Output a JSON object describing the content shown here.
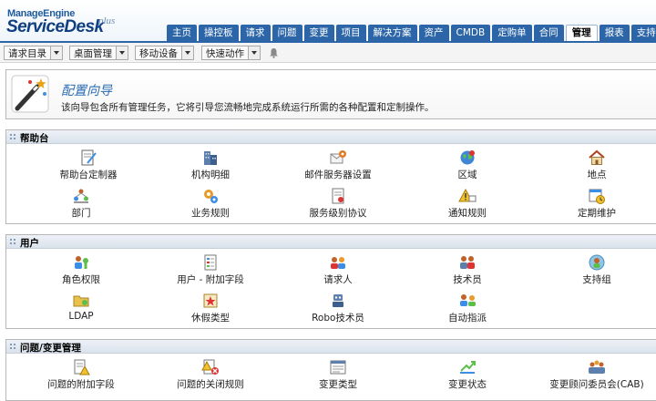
{
  "header": {
    "logo_top": "ManageEngine",
    "logo_main": "ServiceDesk",
    "logo_plus": "plus",
    "tabs": [
      {
        "label": "主页"
      },
      {
        "label": "操控板"
      },
      {
        "label": "请求"
      },
      {
        "label": "问题"
      },
      {
        "label": "变更"
      },
      {
        "label": "项目"
      },
      {
        "label": "解决方案"
      },
      {
        "label": "资产"
      },
      {
        "label": "CMDB"
      },
      {
        "label": "定购单"
      },
      {
        "label": "合同"
      },
      {
        "label": "管理"
      },
      {
        "label": "报表"
      },
      {
        "label": "支持"
      }
    ],
    "active_tab": "管理"
  },
  "toolbar": {
    "dropdowns": [
      {
        "label": "请求目录"
      },
      {
        "label": "桌面管理"
      },
      {
        "label": "移动设备"
      },
      {
        "label": "快速动作"
      }
    ],
    "bell_icon": "bell-icon"
  },
  "wizard": {
    "title": "配置向导",
    "description": "该向导包含所有管理任务，它将引导您流畅地完成系统运行所需的各种配置和定制操作。",
    "icon": "magic-wand-icon"
  },
  "sections": [
    {
      "title": "帮助台",
      "items": [
        {
          "label": "帮助台定制器",
          "icon": "customizer-icon"
        },
        {
          "label": "机构明细",
          "icon": "building-icon"
        },
        {
          "label": "邮件服务器设置",
          "icon": "mail-server-icon"
        },
        {
          "label": "区域",
          "icon": "globe-icon"
        },
        {
          "label": "地点",
          "icon": "house-icon"
        },
        {
          "label": "部门",
          "icon": "department-icon"
        },
        {
          "label": "业务规则",
          "icon": "business-rules-icon"
        },
        {
          "label": "服务级别协议",
          "icon": "sla-icon"
        },
        {
          "label": "通知规则",
          "icon": "notification-icon"
        },
        {
          "label": "定期维护",
          "icon": "calendar-clock-icon"
        }
      ]
    },
    {
      "title": "用户",
      "items": [
        {
          "label": "角色权限",
          "icon": "roles-icon"
        },
        {
          "label": "用户 - 附加字段",
          "icon": "user-fields-icon"
        },
        {
          "label": "请求人",
          "icon": "requesters-icon"
        },
        {
          "label": "技术员",
          "icon": "technicians-icon"
        },
        {
          "label": "支持组",
          "icon": "support-group-icon"
        },
        {
          "label": "LDAP",
          "icon": "ldap-icon"
        },
        {
          "label": "休假类型",
          "icon": "leave-type-icon"
        },
        {
          "label": "Robo技术员",
          "icon": "robot-icon"
        },
        {
          "label": "自动指派",
          "icon": "auto-assign-icon"
        }
      ]
    },
    {
      "title": "问题/变更管理",
      "items": [
        {
          "label": "问题的附加字段",
          "icon": "problem-fields-icon"
        },
        {
          "label": "问题的关闭规则",
          "icon": "closure-rules-icon"
        },
        {
          "label": "变更类型",
          "icon": "change-type-icon"
        },
        {
          "label": "变更状态",
          "icon": "change-status-icon"
        },
        {
          "label": "变更顾问委员会(CAB)",
          "icon": "cab-icon"
        }
      ]
    }
  ],
  "colors": {
    "tab_blue": "#2c66a8",
    "title_blue": "#2b6cb3",
    "section_header": "#d9e2ec"
  }
}
